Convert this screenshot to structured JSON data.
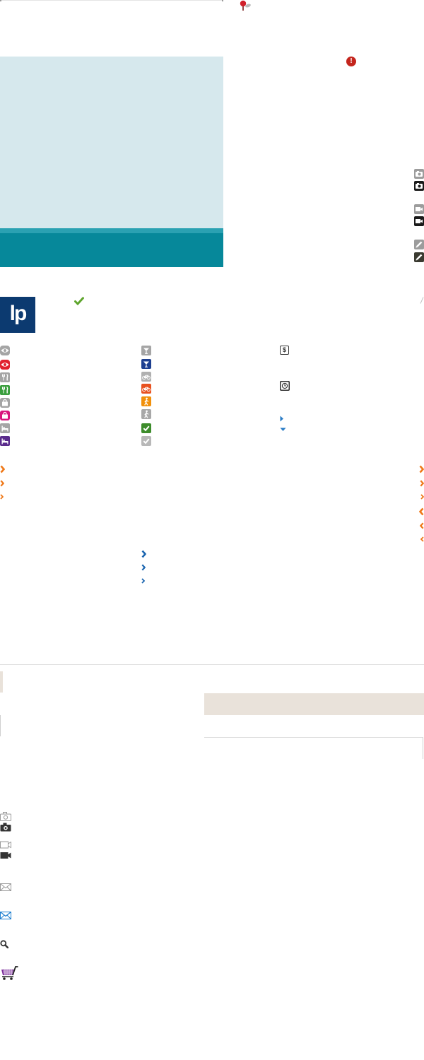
{
  "logo": {
    "text": "lp",
    "icon": "lonely-planet-logo",
    "background": "#0c3a70"
  },
  "top_marker": {
    "icon": "map-pin-icon",
    "color": "#d1202b",
    "stem": "#7a1a1a",
    "shadow": "#b9b9b9"
  },
  "alert": {
    "icon": "alert-icon",
    "glyph": "!",
    "color": "#c4251d"
  },
  "banner": {
    "sky_color": "#d6e8ed",
    "band_edge_color": "#2aa1b2",
    "band_color": "#06889a"
  },
  "side_toggles": [
    {
      "icon": "camera-icon",
      "color": "#9c9c9c"
    },
    {
      "icon": "camera-icon",
      "color": "#1a1a1a"
    },
    {
      "icon": "video-camera-icon",
      "color": "#9c9c9c"
    },
    {
      "icon": "video-camera-icon",
      "color": "#1a1a1a"
    },
    {
      "icon": "pencil-icon",
      "color": "#9c9c9c"
    },
    {
      "icon": "pencil-icon",
      "color": "#3a3a30"
    }
  ],
  "confirm_check": {
    "icon": "check-icon",
    "color": "#5ea52c"
  },
  "category_icons": {
    "column_1": [
      {
        "icon": "eye-icon",
        "color": "#a5a5a5"
      },
      {
        "icon": "eye-icon",
        "color": "#e1222e"
      },
      {
        "icon": "fork-knife-icon",
        "color": "#a5a5a5"
      },
      {
        "icon": "fork-knife-icon",
        "color": "#3c9f3f"
      },
      {
        "icon": "shopping-bag-icon",
        "color": "#a5a5a5"
      },
      {
        "icon": "shopping-bag-icon",
        "color": "#d8167c"
      },
      {
        "icon": "bed-icon",
        "color": "#a5a5a5"
      },
      {
        "icon": "bed-icon",
        "color": "#5a2c8c"
      }
    ],
    "column_2": [
      {
        "icon": "cocktail-icon",
        "color": "#a5a5a5"
      },
      {
        "icon": "cocktail-icon",
        "color": "#1d3f90"
      },
      {
        "icon": "bicycle-icon",
        "color": "#b0b0b0"
      },
      {
        "icon": "bicycle-icon",
        "color": "#e8511f"
      },
      {
        "icon": "walking-person-icon",
        "color": "#f1900b"
      },
      {
        "icon": "walking-person-icon",
        "color": "#a8a8a8"
      },
      {
        "icon": "check-icon",
        "color": "#3d8c2b"
      },
      {
        "icon": "check-icon",
        "color": "#b8b8b8"
      }
    ]
  },
  "info_icons": {
    "money": {
      "icon": "money-icon",
      "glyph": "$",
      "color": "#333333"
    },
    "clock": {
      "icon": "clock-icon",
      "color": "#333333"
    }
  },
  "disclosure": {
    "icon_right": "caret-right-icon",
    "icon_down": "caret-down-icon",
    "color": "#2a7cc6"
  },
  "chevrons": {
    "orange": "#ef7818",
    "blue": "#1c66b0",
    "icon_right": "chevron-right-icon",
    "icon_left": "chevron-left-icon"
  },
  "panels": {
    "tab_color": "#e9e2da",
    "divider_color": "#dddddd"
  },
  "utility_icons": {
    "camera_outline": {
      "icon": "camera-icon",
      "color": "#9a9a9a"
    },
    "camera_solid": {
      "icon": "camera-icon",
      "color": "#333333"
    },
    "video_outline": {
      "icon": "video-camera-icon",
      "color": "#9a9a9a"
    },
    "video_solid": {
      "icon": "video-camera-icon",
      "color": "#333333"
    },
    "mail_gray": {
      "icon": "mail-icon",
      "color": "#9a9a9a"
    },
    "mail_blue": {
      "icon": "mail-icon",
      "color": "#1e7fd0"
    },
    "search": {
      "icon": "search-icon",
      "color": "#333333"
    },
    "cart": {
      "icon": "shopping-cart-icon",
      "color": "#7a2a9a",
      "handle": "#222222"
    }
  }
}
